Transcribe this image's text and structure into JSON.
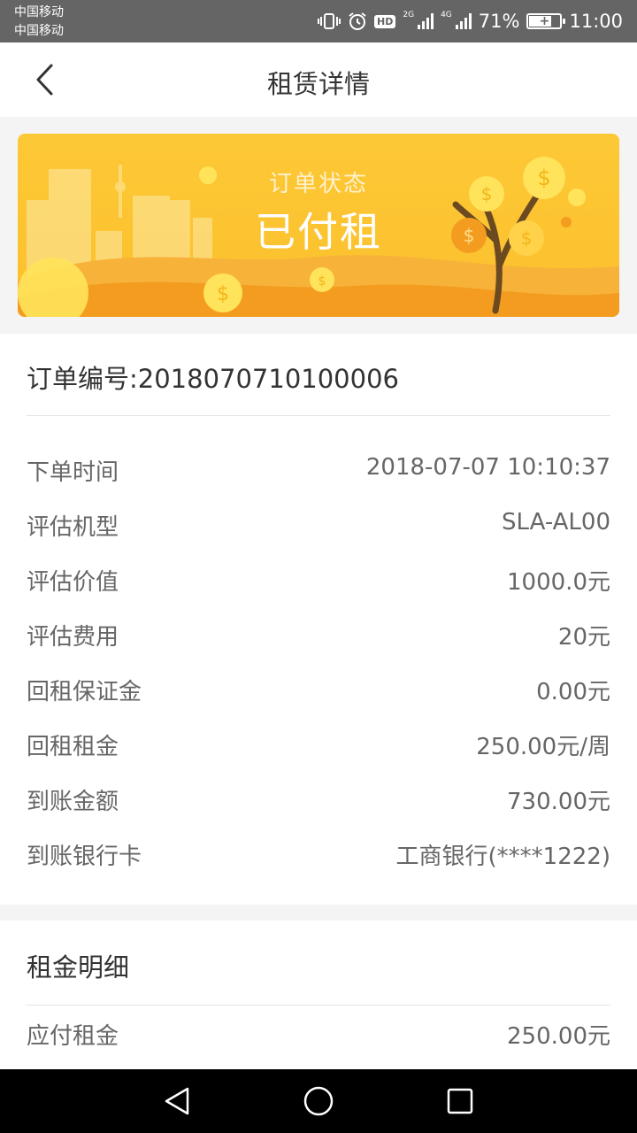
{
  "status_bar": {
    "carrier_1": "中国移动",
    "carrier_2": "中国移动",
    "hd": "HD",
    "net_1": "2G",
    "net_2": "4G",
    "battery_percent": "71%",
    "battery_level": 0.71,
    "time": "11:00",
    "icons": [
      "vibrate-icon",
      "alarm-icon",
      "hd-icon",
      "signal-icon",
      "battery-icon"
    ]
  },
  "header": {
    "title": "租赁详情",
    "back_icon": "chevron-left-icon"
  },
  "banner": {
    "label": "订单状态",
    "status": "已付租",
    "colors": {
      "background": "#fcc02c",
      "hill": "#f5a623",
      "coin": "#ffe048"
    }
  },
  "order": {
    "number": "订单编号:2018070710100006",
    "rows": [
      {
        "label": "下单时间",
        "value": "2018-07-07 10:10:37"
      },
      {
        "label": "评估机型",
        "value": "SLA-AL00"
      },
      {
        "label": "评估价值",
        "value": "1000.0元"
      },
      {
        "label": "评估费用",
        "value": "20元"
      },
      {
        "label": "回租保证金",
        "value": "0.00元"
      },
      {
        "label": "回租租金",
        "value": "250.00元/周"
      },
      {
        "label": "到账金额",
        "value": "730.00元"
      },
      {
        "label": "到账银行卡",
        "value": "工商银行(****1222)"
      }
    ]
  },
  "rent_detail": {
    "title": "租金明细",
    "rows": [
      {
        "label": "应付租金",
        "value": "250.00元"
      }
    ]
  },
  "bottom_nav": {
    "icons": [
      "back-triangle-icon",
      "home-circle-icon",
      "recents-square-icon"
    ]
  }
}
